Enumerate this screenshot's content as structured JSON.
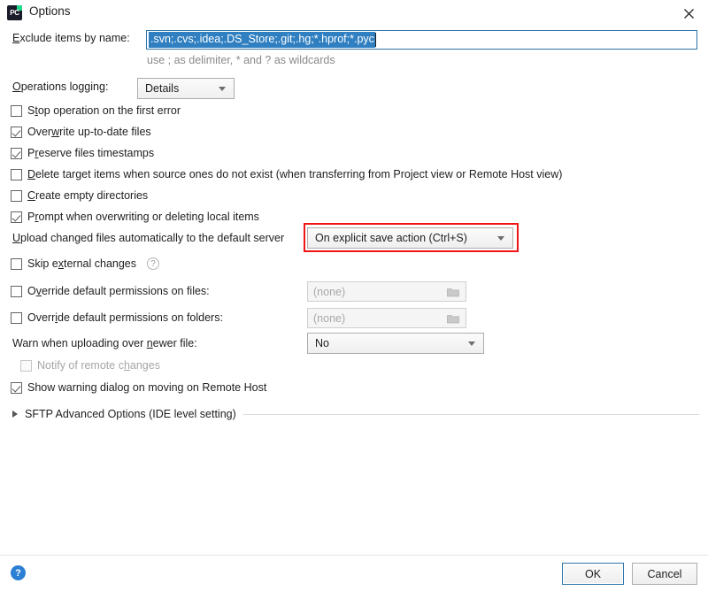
{
  "window": {
    "title": "Options",
    "app_icon": "pycharm-icon",
    "app_icon_text": "PC",
    "close_icon": "close-icon"
  },
  "exclude": {
    "label_prefix": "E",
    "label_rest": "xclude items by name:",
    "value": ".svn;.cvs;.idea;.DS_Store;.git;.hg;*.hprof;*.pyc",
    "hint": "use ; as delimiter, * and ? as wildcards"
  },
  "operations_logging": {
    "label_prefix": "O",
    "label_rest": "perations logging:",
    "value": "Details",
    "options": [
      "Details"
    ]
  },
  "checkboxes": [
    {
      "id": "stop-operation-on-first-error",
      "checked": false,
      "disabled": false,
      "pre": "S",
      "mn": "t",
      "post": "op operation on the first error"
    },
    {
      "id": "overwrite-up-to-date-files",
      "checked": true,
      "disabled": false,
      "pre": "Over",
      "mn": "w",
      "post": "rite up-to-date files"
    },
    {
      "id": "preserve-files-timestamps",
      "checked": true,
      "disabled": false,
      "pre": "P",
      "mn": "r",
      "post": "eserve files timestamps"
    },
    {
      "id": "delete-target-items",
      "checked": false,
      "disabled": false,
      "pre": "",
      "mn": "D",
      "post": "elete target items when source ones do not exist (when transferring from Project view or Remote Host view)"
    },
    {
      "id": "create-empty-directories",
      "checked": false,
      "disabled": false,
      "pre": "",
      "mn": "C",
      "post": "reate empty directories"
    },
    {
      "id": "prompt-when-overwriting",
      "checked": true,
      "disabled": false,
      "pre": "P",
      "mn": "r",
      "post": "ompt when overwriting or deleting local items"
    }
  ],
  "upload_changed": {
    "label_prefix": "U",
    "label_rest": "pload changed files automatically to the default server",
    "value": "On explicit save action (Ctrl+S)",
    "options": [
      "On explicit save action (Ctrl+S)"
    ],
    "highlight_color": "#f01414"
  },
  "skip_external": {
    "checked": false,
    "pre": "Skip e",
    "mn": "x",
    "post": "ternal changes",
    "help_icon": "question-circle-icon"
  },
  "override_files": {
    "checked": false,
    "pre": "O",
    "mn": "v",
    "post": "erride default permissions on files:",
    "value": "(none)",
    "browse_icon": "folder-icon"
  },
  "override_folders": {
    "checked": false,
    "pre": "Overr",
    "mn": "i",
    "post": "de default permissions on folders:",
    "value": "(none)",
    "browse_icon": "folder-icon"
  },
  "warn_newer": {
    "pre": "Warn when uploading over ",
    "mn": "n",
    "post": "ewer file:",
    "value": "No",
    "options": [
      "No"
    ]
  },
  "notify_remote": {
    "checked": false,
    "disabled": true,
    "pre": "Notify of remote c",
    "mn": "h",
    "post": "anges"
  },
  "show_warning_dialog": {
    "checked": true,
    "label": "Show warning dialog on moving on Remote Host"
  },
  "sftp_advanced": {
    "label": "SFTP Advanced Options (IDE level setting)",
    "expanded": false,
    "arrow_icon": "chevron-right-icon"
  },
  "footer": {
    "help_icon": "help-circle-icon",
    "help_glyph": "?",
    "ok_label": "OK",
    "cancel_label": "Cancel"
  }
}
